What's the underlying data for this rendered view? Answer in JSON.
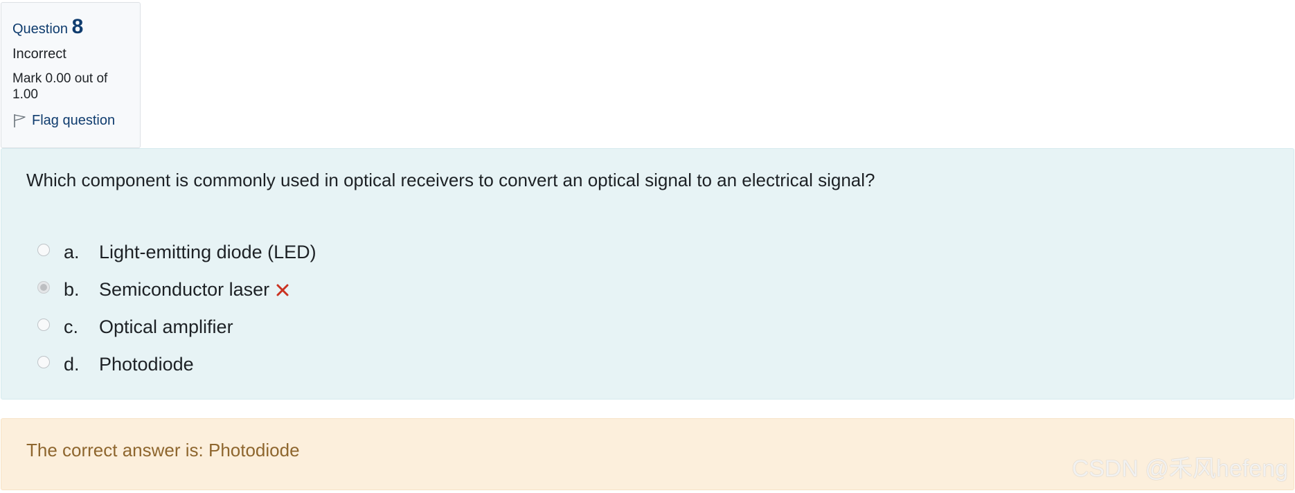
{
  "info": {
    "question_label": "Question",
    "question_number": "8",
    "state": "Incorrect",
    "grade": "Mark 0.00 out of 1.00",
    "flag_label": "Flag question",
    "flag_icon": "flag-outline-icon"
  },
  "question": {
    "text": "Which component is commonly used in optical receivers to convert an optical signal to an electrical signal?",
    "options": [
      {
        "letter": "a.",
        "label": "Light-emitting diode (LED)",
        "selected": false
      },
      {
        "letter": "b.",
        "label": "Semiconductor laser",
        "selected": true,
        "status_icon": "incorrect-x-icon"
      },
      {
        "letter": "c.",
        "label": "Optical amplifier",
        "selected": false
      },
      {
        "letter": "d.",
        "label": "Photodiode",
        "selected": false
      }
    ]
  },
  "feedback": {
    "right_answer": "The correct answer is: Photodiode"
  },
  "watermark": "CSDN @禾风hefeng",
  "colors": {
    "info_bg": "#f7f9fb",
    "question_blue": "#0f3c6e",
    "formulation_bg": "#e7f3f5",
    "feedback_bg": "#fcefdc",
    "feedback_text": "#8e662e",
    "incorrect_red": "#ca3120"
  }
}
